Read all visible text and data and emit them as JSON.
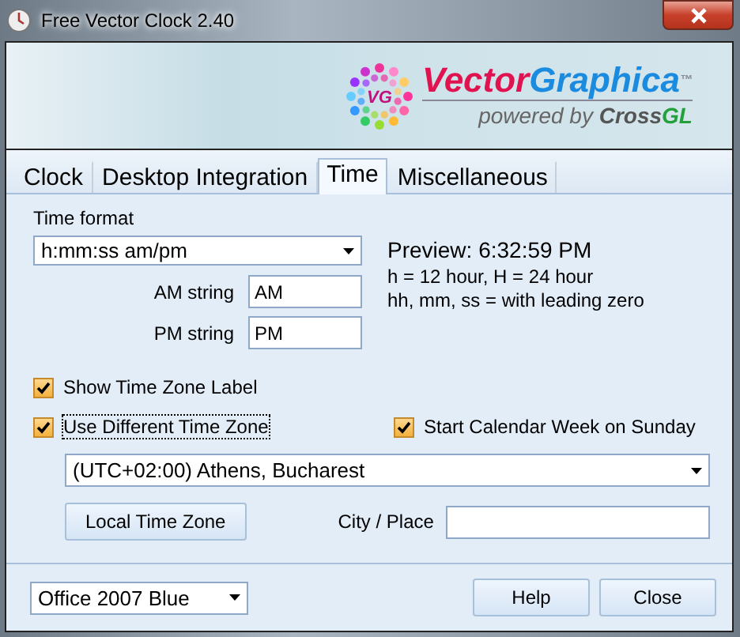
{
  "window": {
    "title": "Free Vector Clock 2.40"
  },
  "banner": {
    "brand_first": "Vector",
    "brand_second": "Graphica",
    "trademark": "™",
    "tagline": "powered by",
    "partner_first": "Cross",
    "partner_second": "GL",
    "badge": "VG"
  },
  "tabs": [
    {
      "label": "Clock",
      "selected": false
    },
    {
      "label": "Desktop Integration",
      "selected": false
    },
    {
      "label": "Time",
      "selected": true
    },
    {
      "label": "Miscellaneous",
      "selected": false
    }
  ],
  "time_format": {
    "label": "Time format",
    "value": "h:mm:ss am/pm"
  },
  "am_string": {
    "label": "AM string",
    "value": "AM"
  },
  "pm_string": {
    "label": "PM string",
    "value": "PM"
  },
  "preview": {
    "text": "Preview: 6:32:59 PM",
    "hints": [
      "h = 12 hour, H = 24 hour",
      "hh, mm, ss = with leading zero"
    ]
  },
  "checkboxes": [
    {
      "label": "Show Time Zone Label",
      "checked": true,
      "focused": false
    },
    {
      "label": "Use Different Time Zone",
      "checked": true,
      "focused": true
    },
    {
      "label": "Start Calendar Week on Sunday",
      "checked": true,
      "focused": false
    }
  ],
  "time_zone": {
    "value": "(UTC+02:00) Athens, Bucharest"
  },
  "local_time_zone_button": "Local Time Zone",
  "city": {
    "label": "City / Place"
  },
  "theme": {
    "value": "Office 2007 Blue"
  },
  "buttons": [
    "Help",
    "Close"
  ]
}
